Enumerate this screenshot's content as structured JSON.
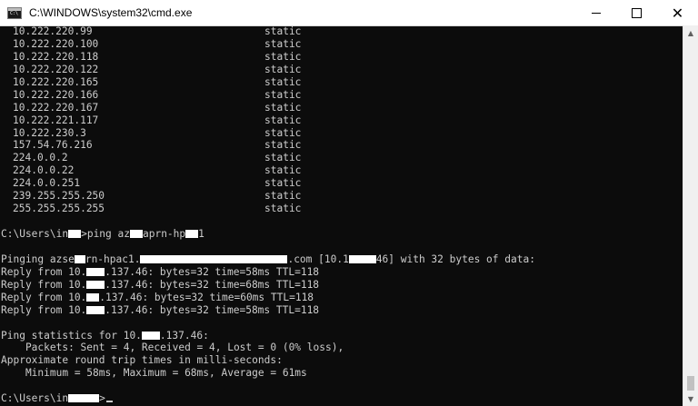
{
  "window": {
    "title": "C:\\WINDOWS\\system32\\cmd.exe",
    "icon_text": "C:\\",
    "controls": {
      "minimize": "—",
      "maximize": "□",
      "close": "✕"
    }
  },
  "routes": [
    {
      "ip": "10.222.220.99",
      "type": "static"
    },
    {
      "ip": "10.222.220.100",
      "type": "static"
    },
    {
      "ip": "10.222.220.118",
      "type": "static"
    },
    {
      "ip": "10.222.220.122",
      "type": "static"
    },
    {
      "ip": "10.222.220.165",
      "type": "static"
    },
    {
      "ip": "10.222.220.166",
      "type": "static"
    },
    {
      "ip": "10.222.220.167",
      "type": "static"
    },
    {
      "ip": "10.222.221.117",
      "type": "static"
    },
    {
      "ip": "10.222.230.3",
      "type": "static"
    },
    {
      "ip": "157.54.76.216",
      "type": "static"
    },
    {
      "ip": "224.0.0.2",
      "type": "static"
    },
    {
      "ip": "224.0.0.22",
      "type": "static"
    },
    {
      "ip": "224.0.0.251",
      "type": "static"
    },
    {
      "ip": "239.255.255.250",
      "type": "static"
    },
    {
      "ip": "255.255.255.255",
      "type": "static"
    }
  ],
  "command": {
    "prompt_a": "C:\\Users\\in",
    "prompt_b": ">ping az",
    "prompt_c": "aprn-hp",
    "prompt_d": "1"
  },
  "pinging": {
    "p1": "Pinging azse",
    "p2": "rn-hpac1.",
    "p3": ".com [10.1",
    "p4": "46] with 32 bytes of data:"
  },
  "replies": [
    {
      "pre": "Reply from 10.",
      "post": ".137.46: bytes=32 time=58ms TTL=118"
    },
    {
      "pre": "Reply from 10.",
      "post": ".137.46: bytes=32 time=68ms TTL=118"
    },
    {
      "pre": "Reply from 10.",
      "post": ".137.46: bytes=32 time=60ms TTL=118"
    },
    {
      "pre": "Reply from 10.",
      "post": ".137.46: bytes=32 time=58ms TTL=118"
    }
  ],
  "stats": {
    "header_pre": "Ping statistics for 10.",
    "header_post": ".137.46:",
    "packets": "    Packets: Sent = 4, Received = 4, Lost = 0 (0% loss),",
    "approx": "Approximate round trip times in milli-seconds:",
    "times": "    Minimum = 58ms, Maximum = 68ms, Average = 61ms"
  },
  "final_prompt": {
    "a": "C:\\Users\\in",
    "b": ">"
  },
  "scrollbar": {
    "up_arrow": "▲",
    "down_arrow": "▼"
  }
}
